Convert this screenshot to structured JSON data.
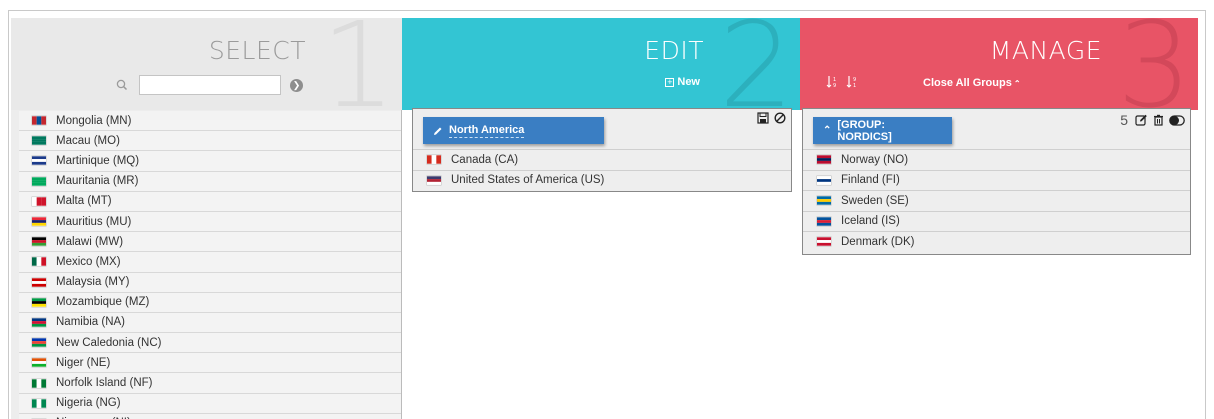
{
  "select": {
    "title": "SELECT",
    "step": "1",
    "search_value": "",
    "countries": [
      {
        "label": "Mongolia (MN)",
        "flag": [
          "#c4272f",
          "#015197",
          "#c4272f"
        ],
        "dir": "h"
      },
      {
        "label": "Macau (MO)",
        "flag": [
          "#00785e",
          "#00785e",
          "#00785e"
        ],
        "dir": "v"
      },
      {
        "label": "Martinique (MQ)",
        "flag": [
          "#1b3a8a",
          "#ffffff",
          "#1b3a8a"
        ],
        "dir": "v"
      },
      {
        "label": "Mauritania (MR)",
        "flag": [
          "#00a95c",
          "#00a95c",
          "#00a95c"
        ],
        "dir": "v"
      },
      {
        "label": "Malta (MT)",
        "flag": [
          "#ffffff",
          "#cf142b",
          "#cf142b"
        ],
        "dir": "h"
      },
      {
        "label": "Mauritius (MU)",
        "flag": [
          "#ea2839",
          "#1a206d",
          "#ffd500"
        ],
        "dir": "v"
      },
      {
        "label": "Malawi (MW)",
        "flag": [
          "#000000",
          "#ce1126",
          "#339e35"
        ],
        "dir": "v"
      },
      {
        "label": "Mexico (MX)",
        "flag": [
          "#006847",
          "#ffffff",
          "#ce1126"
        ],
        "dir": "h"
      },
      {
        "label": "Malaysia (MY)",
        "flag": [
          "#cc0001",
          "#ffffff",
          "#cc0001"
        ],
        "dir": "v"
      },
      {
        "label": "Mozambique (MZ)",
        "flag": [
          "#009a44",
          "#000000",
          "#fce100"
        ],
        "dir": "v"
      },
      {
        "label": "Namibia (NA)",
        "flag": [
          "#003580",
          "#d21034",
          "#009543"
        ],
        "dir": "v"
      },
      {
        "label": "New Caledonia (NC)",
        "flag": [
          "#0035ad",
          "#ed4135",
          "#009543"
        ],
        "dir": "v"
      },
      {
        "label": "Niger (NE)",
        "flag": [
          "#e05206",
          "#ffffff",
          "#0db02b"
        ],
        "dir": "v"
      },
      {
        "label": "Norfolk Island (NF)",
        "flag": [
          "#007934",
          "#ffffff",
          "#007934"
        ],
        "dir": "h"
      },
      {
        "label": "Nigeria (NG)",
        "flag": [
          "#008751",
          "#ffffff",
          "#008751"
        ],
        "dir": "h"
      },
      {
        "label": "Nicaragua (NI)",
        "flag": [
          "#0067c6",
          "#ffffff",
          "#0067c6"
        ],
        "dir": "v"
      }
    ]
  },
  "edit": {
    "title": "EDIT",
    "step": "2",
    "new_label": "New",
    "group_name": "North America",
    "items": [
      {
        "label": "Canada (CA)",
        "flag": [
          "#d52b1e",
          "#ffffff",
          "#d52b1e"
        ],
        "dir": "h"
      },
      {
        "label": "United States of America (US)",
        "flag": [
          "#3c3b6e",
          "#b22234",
          "#ffffff"
        ],
        "dir": "v"
      }
    ]
  },
  "manage": {
    "title": "MANAGE",
    "step": "3",
    "close_all_label": "Close All Groups",
    "group_name": "[GROUP: NORDICS]",
    "count": "5",
    "items": [
      {
        "label": "Norway (NO)",
        "flag": [
          "#ba0c2f",
          "#00205b",
          "#ba0c2f"
        ],
        "dir": "v"
      },
      {
        "label": "Finland (FI)",
        "flag": [
          "#ffffff",
          "#003580",
          "#ffffff"
        ],
        "dir": "v"
      },
      {
        "label": "Sweden (SE)",
        "flag": [
          "#006aa7",
          "#fecc00",
          "#006aa7"
        ],
        "dir": "v"
      },
      {
        "label": "Iceland (IS)",
        "flag": [
          "#02529c",
          "#dc1e35",
          "#02529c"
        ],
        "dir": "v"
      },
      {
        "label": "Denmark (DK)",
        "flag": [
          "#c8102e",
          "#ffffff",
          "#c8102e"
        ],
        "dir": "v"
      }
    ]
  },
  "colors": {
    "select_header": "#e9e9e9",
    "edit_header": "#33c5d3",
    "manage_header": "#e85466",
    "group_title_bg": "#3a7ec3"
  }
}
